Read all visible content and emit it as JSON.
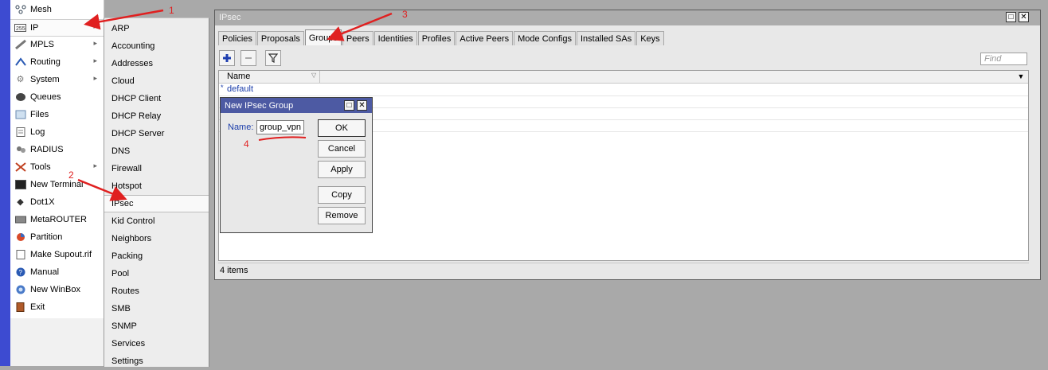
{
  "colors": {
    "annotation": "#e02020",
    "link_blue": "#1a3caa",
    "strip_blue": "#3d4bd1",
    "dialog_title": "#4d5aa3"
  },
  "main_menu": {
    "items": [
      {
        "label": "Mesh",
        "icon": "mesh-icon",
        "submenu": false
      },
      {
        "label": "IP",
        "icon": "ip-icon",
        "submenu": true
      },
      {
        "label": "MPLS",
        "icon": "mpls-icon",
        "submenu": true
      },
      {
        "label": "Routing",
        "icon": "routing-icon",
        "submenu": true
      },
      {
        "label": "System",
        "icon": "system-gear-icon",
        "submenu": true
      },
      {
        "label": "Queues",
        "icon": "queues-icon",
        "submenu": false
      },
      {
        "label": "Files",
        "icon": "files-icon",
        "submenu": false
      },
      {
        "label": "Log",
        "icon": "log-icon",
        "submenu": false
      },
      {
        "label": "RADIUS",
        "icon": "radius-icon",
        "submenu": false
      },
      {
        "label": "Tools",
        "icon": "tools-icon",
        "submenu": true
      },
      {
        "label": "New Terminal",
        "icon": "terminal-icon",
        "submenu": false
      },
      {
        "label": "Dot1X",
        "icon": "dot1x-icon",
        "submenu": false
      },
      {
        "label": "MetaROUTER",
        "icon": "metarouter-icon",
        "submenu": false
      },
      {
        "label": "Partition",
        "icon": "partition-icon",
        "submenu": false
      },
      {
        "label": "Make Supout.rif",
        "icon": "supout-icon",
        "submenu": false
      },
      {
        "label": "Manual",
        "icon": "manual-help-icon",
        "submenu": false
      },
      {
        "label": "New WinBox",
        "icon": "winbox-icon",
        "submenu": false
      },
      {
        "label": "Exit",
        "icon": "exit-icon",
        "submenu": false
      }
    ]
  },
  "ip_submenu": {
    "items": [
      "ARP",
      "Accounting",
      "Addresses",
      "Cloud",
      "DHCP Client",
      "DHCP Relay",
      "DHCP Server",
      "DNS",
      "Firewall",
      "Hotspot",
      "IPsec",
      "Kid Control",
      "Neighbors",
      "Packing",
      "Pool",
      "Routes",
      "SMB",
      "SNMP",
      "Services",
      "Settings"
    ]
  },
  "ipsec_window": {
    "title": "IPsec",
    "tabs": [
      "Policies",
      "Proposals",
      "Groups",
      "Peers",
      "Identities",
      "Profiles",
      "Active Peers",
      "Mode Configs",
      "Installed SAs",
      "Keys"
    ],
    "active_tab": "Groups",
    "find_placeholder": "Find",
    "column_name": "Name",
    "rows": [
      {
        "marker": "*",
        "name": "default"
      },
      {
        "marker": "",
        "name": ""
      },
      {
        "marker": "",
        "name": ""
      },
      {
        "marker": "",
        "name": ""
      }
    ],
    "status": "4 items"
  },
  "dialog": {
    "title": "New IPsec Group",
    "name_label": "Name:",
    "name_value": "group_vpn",
    "buttons": {
      "ok": "OK",
      "cancel": "Cancel",
      "apply": "Apply",
      "copy": "Copy",
      "remove": "Remove"
    }
  },
  "annotations": [
    "1",
    "2",
    "3",
    "4"
  ]
}
